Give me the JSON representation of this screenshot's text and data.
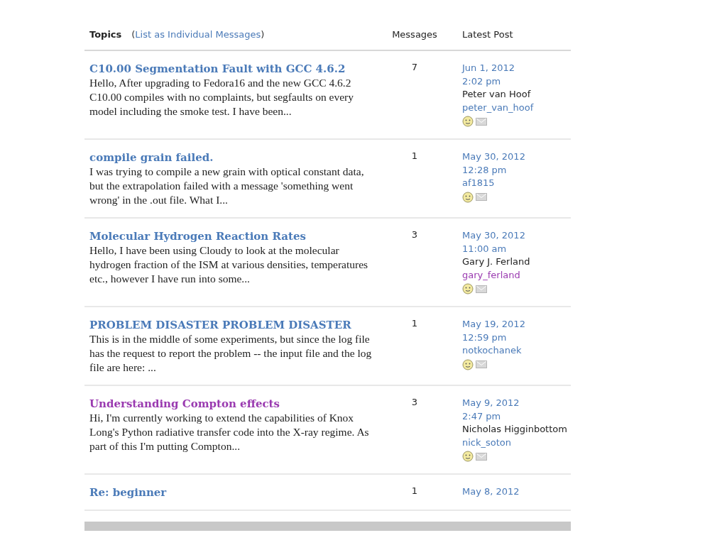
{
  "header": {
    "topics": "Topics",
    "list_link": "List as Individual Messages",
    "list_link_open": "(",
    "list_link_close": ")",
    "messages": "Messages",
    "latest_post": "Latest Post"
  },
  "topics": [
    {
      "title": "C10.00 Segmentation Fault with GCC 4.6.2",
      "visited": false,
      "excerpt": "Hello, After upgrading to Fedora16 and the new GCC 4.6.2 C10.00 compiles with no complaints, but segfaults on every model including the smoke test. I have been...",
      "messages": "7",
      "date": "Jun 1, 2012",
      "time": "2:02 pm",
      "author": "Peter van Hoof",
      "username": "peter_van_hoof",
      "username_visited": false
    },
    {
      "title": "compile grain failed.",
      "visited": false,
      "excerpt": "I was trying to compile a new grain with optical constant data, but the extrapolation failed with a message 'something went wrong' in the .out file. What I...",
      "messages": "1",
      "date": "May 30, 2012",
      "time": "12:28 pm",
      "username": "af1815",
      "username_visited": false
    },
    {
      "title": "Molecular Hydrogen Reaction Rates",
      "visited": false,
      "excerpt": "Hello, I have been using Cloudy to look at the molecular hydrogen fraction of the ISM at various densities, temperatures etc., however I have run into some...",
      "messages": "3",
      "date": "May 30, 2012",
      "time": "11:00 am",
      "author": "Gary J. Ferland",
      "username": "gary_ferland",
      "username_visited": true
    },
    {
      "title": "PROBLEM DISASTER PROBLEM DISASTER",
      "visited": false,
      "excerpt": "This is in the middle of some experiments, but since the log file has the request to report the problem -- the input file and the log file are here: ...",
      "messages": "1",
      "date": "May 19, 2012",
      "time": "12:59 pm",
      "username": "notkochanek",
      "username_visited": false
    },
    {
      "title": "Understanding Compton effects",
      "visited": true,
      "excerpt": "Hi, I'm currently working to extend the capabilities of Knox Long's Python radiative transfer code into the X-ray regime. As part of this I'm putting Compton...",
      "messages": "3",
      "date": "May 9, 2012",
      "time": "2:47 pm",
      "author": "Nicholas Higginbottom",
      "username": "nick_soton",
      "username_visited": false
    },
    {
      "title": "Re: beginner",
      "visited": false,
      "messages": "1",
      "date": "May 8, 2012"
    }
  ]
}
